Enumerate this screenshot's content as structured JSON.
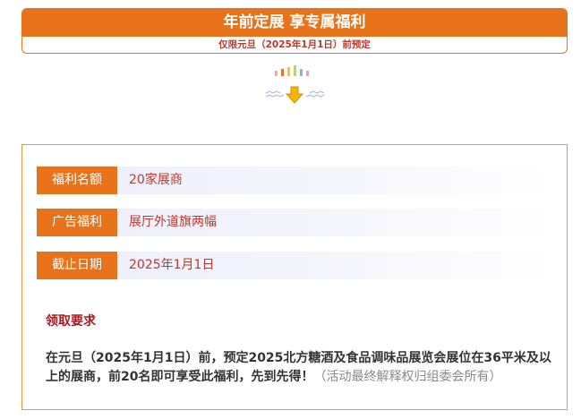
{
  "banner": {
    "title": "年前定展  享专属福利",
    "subtitle": "仅限元旦（2025年1月1日）前预定"
  },
  "decor": {
    "bar_colors": [
      "#f5a7a0",
      "#e8731a",
      "#f3c24a",
      "#b4d37c",
      "#8fb0e6",
      "#c9a7e6"
    ],
    "arrow_color": "#f4b400"
  },
  "benefits": [
    {
      "label": "福利名额",
      "value": "20家展商"
    },
    {
      "label": "广告福利",
      "value": "展厅外道旗两幅"
    },
    {
      "label": "截止日期",
      "value": "2025年1月1日"
    }
  ],
  "requirements": {
    "title": "领取要求",
    "text": "在元旦（2025年1月1日）前，预定2025北方糖酒及食品调味品展览会展位在36平米及以上的展商，前20名即可享受此福利，先到先得！",
    "note": "（活动最终解释权归组委会所有）"
  }
}
